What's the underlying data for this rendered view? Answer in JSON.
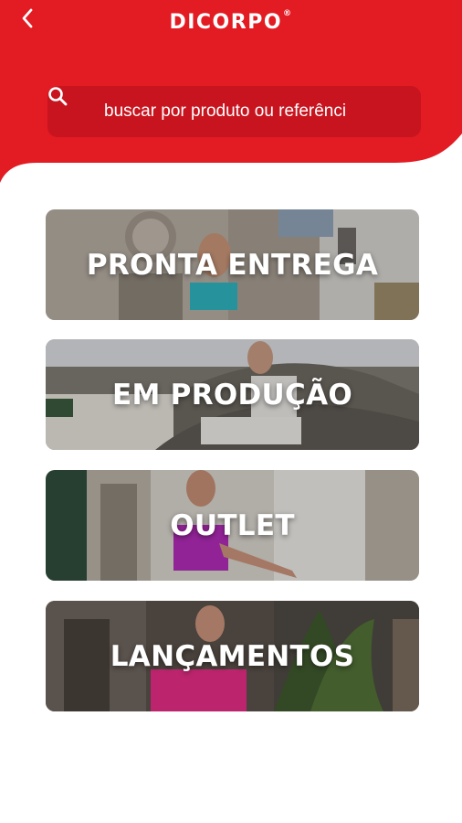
{
  "header": {
    "brand": "DICORPO",
    "brand_mark": "®",
    "background_color": "#e31b23"
  },
  "search": {
    "placeholder": "buscar por produto ou referênci"
  },
  "categories": [
    {
      "label": "PRONTA ENTREGA"
    },
    {
      "label": "EM PRODUÇÃO"
    },
    {
      "label": "OUTLET"
    },
    {
      "label": "LANÇAMENTOS"
    }
  ],
  "icons": {
    "back": "chevron-left-icon",
    "search": "search-icon"
  }
}
